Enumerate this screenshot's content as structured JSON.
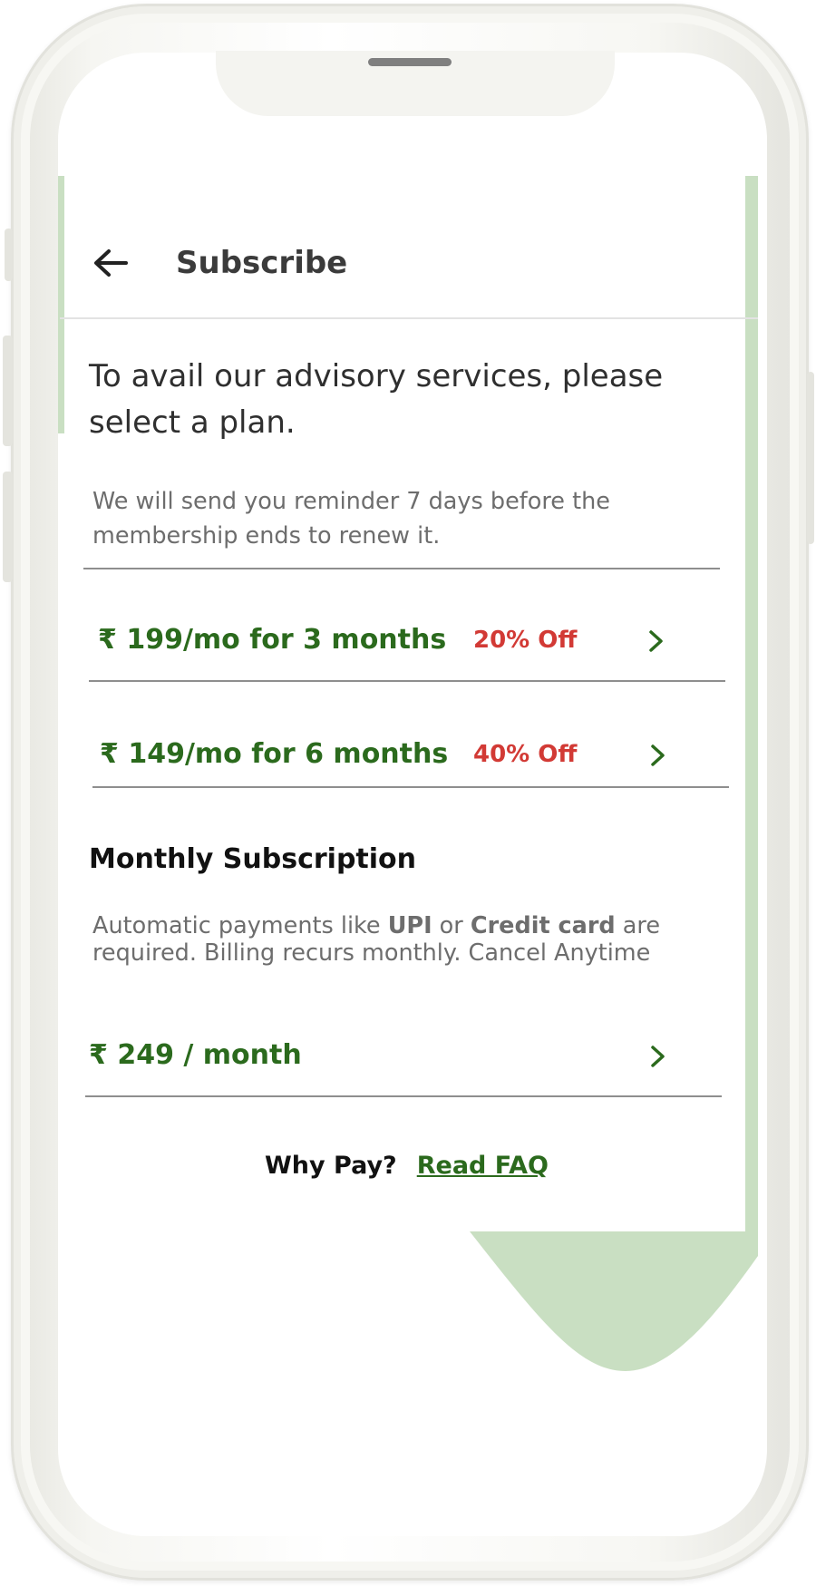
{
  "header": {
    "title": "Subscribe",
    "back_icon": "arrow-left-icon"
  },
  "intro": "To avail our advisory services, please select a plan.",
  "reminder": "We will send you reminder 7 days before the membership ends to renew it.",
  "plans": [
    {
      "price": "₹ 199/mo for 3 months",
      "discount": "20% Off",
      "icon": "chevron-right-icon"
    },
    {
      "price": "₹ 149/mo for 6 months",
      "discount": "40% Off",
      "icon": "chevron-right-icon"
    }
  ],
  "monthly": {
    "title": "Monthly Subscription",
    "desc_prefix": "Automatic payments like ",
    "desc_upi": "UPI",
    "desc_or": " or ",
    "desc_card": "Credit card",
    "desc_suffix": " are required. Billing recurs monthly. Cancel Anytime",
    "price": "₹ 249 / month",
    "icon": "chevron-right-icon"
  },
  "faq": {
    "question": "Why Pay?",
    "link": "Read FAQ"
  },
  "colors": {
    "price_green": "#2b6a1d",
    "discount_red": "#d23a35",
    "decor_green": "#c9dfc2",
    "text_dark": "#2f2f2f",
    "text_muted": "#6d6d6d"
  }
}
